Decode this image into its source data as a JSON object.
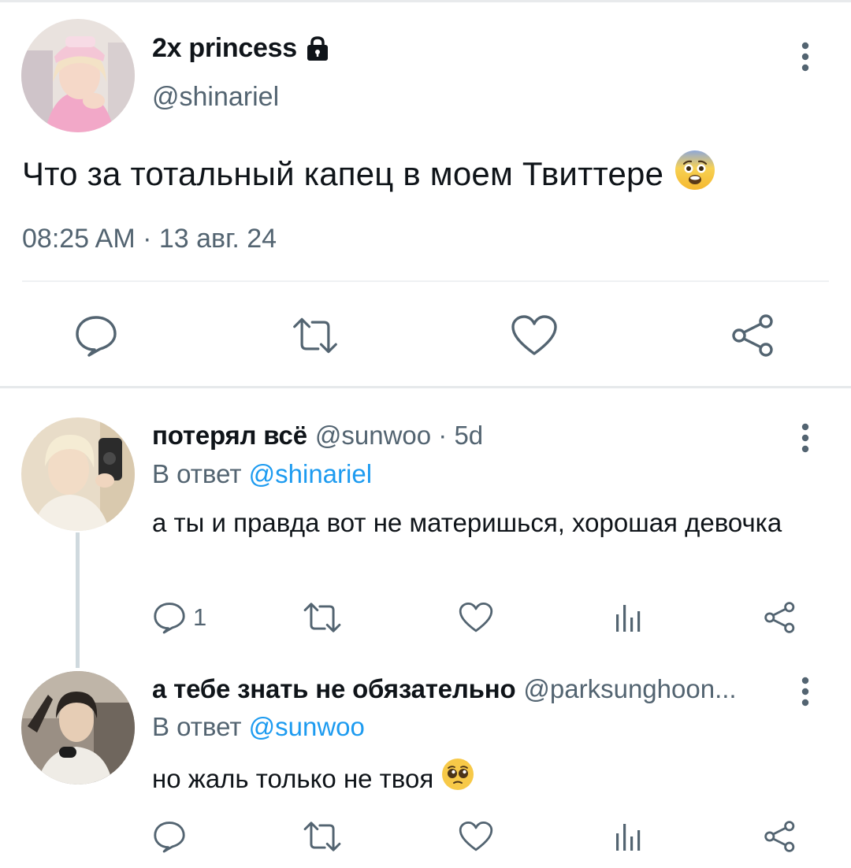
{
  "main_tweet": {
    "name": "2x princess",
    "handle": "@shinariel",
    "text": "Что за тотальный капец в моем Твиттере",
    "emoji": "fearful-face-emoji",
    "timestamp": "08:25 AM · 13 авг. 24",
    "icons": [
      "lock-icon",
      "more-icon",
      "reply-icon",
      "retweet-icon",
      "like-icon",
      "share-icon"
    ]
  },
  "replies": [
    {
      "name": "потерял всё",
      "meta": "@sunwoo · 5d",
      "reply_to_label": "В ответ",
      "reply_to_mention": "@shinariel",
      "text": "а ты и правда вот не материшься, хорошая девочка",
      "reply_count": "1",
      "icons": [
        "more-icon",
        "reply-icon",
        "retweet-icon",
        "like-icon",
        "views-icon",
        "share-icon"
      ]
    },
    {
      "name": "а тебе знать не обязательно",
      "meta": "@parksunghoon...",
      "reply_to_label": "В ответ",
      "reply_to_mention": "@sunwoo",
      "text": "но жаль только не твоя",
      "emoji": "pleading-face-emoji",
      "icons": [
        "more-icon",
        "reply-icon",
        "retweet-icon",
        "like-icon",
        "views-icon",
        "share-icon"
      ]
    }
  ],
  "colors": {
    "text": "#0f1419",
    "secondary": "#536471",
    "link": "#1d9bf0",
    "divider": "#eff1f3",
    "thread_line": "#cfd9de"
  }
}
